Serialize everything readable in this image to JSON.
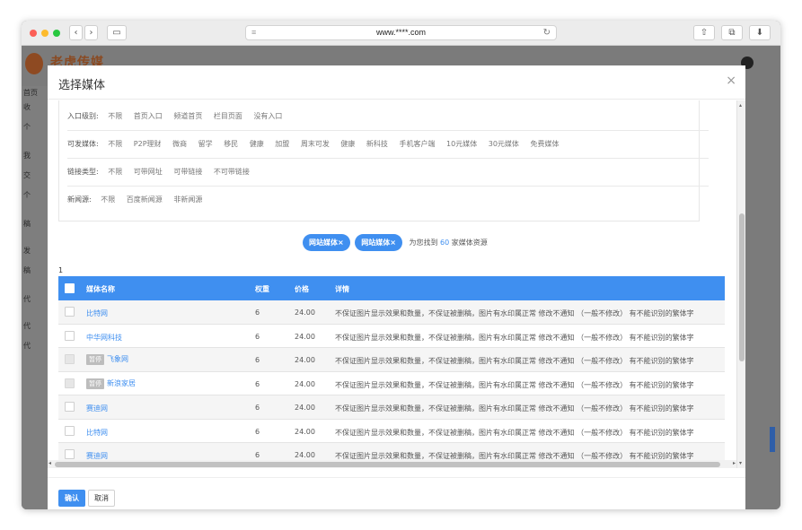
{
  "browser": {
    "url": "www.****.com",
    "icons": [
      "back-icon",
      "forward-icon",
      "sidebar-icon",
      "reader-icon",
      "reload-icon",
      "share-icon",
      "tabs-icon",
      "download-icon"
    ]
  },
  "background": {
    "brand": "老虎传媒",
    "sidebar_items": [
      "首页",
      "收",
      "个",
      "我",
      "交",
      "个",
      "稿",
      "发",
      "稿",
      "代",
      "代",
      "代"
    ]
  },
  "modal": {
    "title": "选择媒体",
    "close_label": "×",
    "filters": [
      {
        "label": "入口级别:",
        "options": [
          "不限",
          "首页入口",
          "频道首页",
          "栏目页面",
          "没有入口"
        ]
      },
      {
        "label": "可发媒体:",
        "options": [
          "不限",
          "P2P理财",
          "微商",
          "留学",
          "移民",
          "健康",
          "加盟",
          "周末可发",
          "健康",
          "新科技",
          "手机客户端",
          "10元媒体",
          "30元媒体",
          "免费媒体"
        ]
      },
      {
        "label": "链接类型:",
        "options": [
          "不限",
          "可带网址",
          "可带链接",
          "不可带链接"
        ]
      },
      {
        "label": "新闻源:",
        "options": [
          "不限",
          "百度新闻源",
          "非新闻源"
        ]
      }
    ],
    "selected_tags": [
      "网站媒体×",
      "网站媒体×"
    ],
    "result_prefix": "为您找到",
    "result_count": "60",
    "result_suffix": "家媒体资源",
    "page_number": "1",
    "table": {
      "headers": {
        "name": "媒体名称",
        "weight": "权重",
        "price": "价格",
        "detail": "详情"
      },
      "rows": [
        {
          "name": "比特网",
          "paused": "",
          "weight": "6",
          "price": "24.00",
          "detail": "不保证图片显示效果和数量，不保证被删稿，图片有水印属正常 修改不通知 （一般不修改） 有不能识别的繁体字"
        },
        {
          "name": "中华网科技",
          "paused": "",
          "weight": "6",
          "price": "24.00",
          "detail": "不保证图片显示效果和数量，不保证被删稿，图片有水印属正常 修改不通知 （一般不修改） 有不能识别的繁体字"
        },
        {
          "name": "飞象网",
          "paused": "暂停",
          "weight": "6",
          "price": "24.00",
          "detail": "不保证图片显示效果和数量，不保证被删稿，图片有水印属正常 修改不通知 （一般不修改） 有不能识别的繁体字"
        },
        {
          "name": "新浪家居",
          "paused": "暂停",
          "weight": "6",
          "price": "24.00",
          "detail": "不保证图片显示效果和数量，不保证被删稿，图片有水印属正常 修改不通知 （一般不修改） 有不能识别的繁体字"
        },
        {
          "name": "赛迪网",
          "paused": "",
          "weight": "6",
          "price": "24.00",
          "detail": "不保证图片显示效果和数量，不保证被删稿，图片有水印属正常 修改不通知 （一般不修改） 有不能识别的繁体字"
        },
        {
          "name": "比特网",
          "paused": "",
          "weight": "6",
          "price": "24.00",
          "detail": "不保证图片显示效果和数量，不保证被删稿，图片有水印属正常 修改不通知 （一般不修改） 有不能识别的繁体字"
        },
        {
          "name": "赛迪网",
          "paused": "",
          "weight": "6",
          "price": "24.00",
          "detail": "不保证图片显示效果和数量，不保证被删稿，图片有水印属正常 修改不通知 （一般不修改） 有不能识别的繁体字"
        }
      ]
    },
    "footer": {
      "confirm": "确认",
      "cancel": "取消"
    }
  },
  "colors": {
    "accent": "#3f8ff0",
    "overlay": "#7b7b7b"
  }
}
